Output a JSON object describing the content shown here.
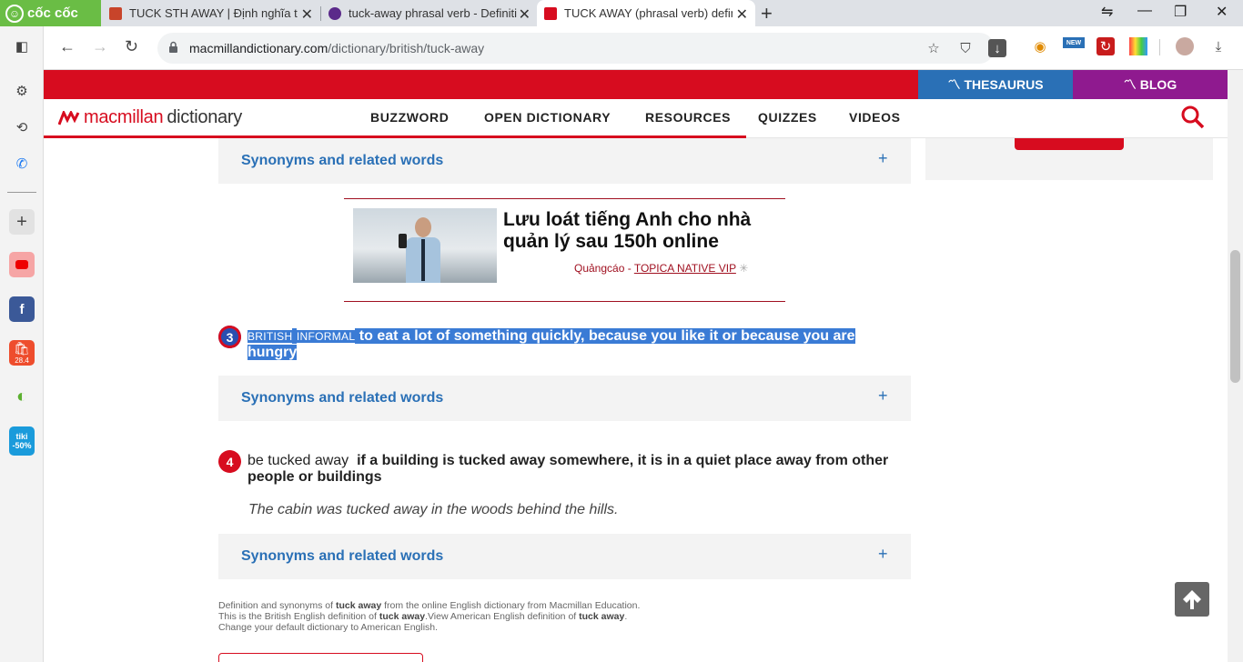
{
  "browser": {
    "brand": "cốc cốc",
    "tabs": [
      {
        "title": "TUCK STH AWAY | Định nghĩa trong",
        "favicon_color": "#c8442a"
      },
      {
        "title": "tuck-away phrasal verb - Definition",
        "favicon_color": "#5b2a8a"
      },
      {
        "title": "TUCK AWAY (phrasal verb) definition",
        "favicon_color": "#d70c1f",
        "active": true
      }
    ],
    "url_host": "macmillandictionary.com",
    "url_path": "/dictionary/british/tuck-away",
    "sidebar_badges": {
      "shopee": "28.4",
      "tiki_top": "tiki",
      "tiki_bottom": "-50%"
    },
    "toolbar_badge": "NEW"
  },
  "site": {
    "logo_brand": "macmillan",
    "logo_dict": " dictionary",
    "top_links": {
      "thesaurus": "THESAURUS",
      "blog": "BLOG"
    },
    "nav": [
      "BUZZWORD",
      "OPEN DICTIONARY",
      "RESOURCES",
      "QUIZZES",
      "VIDEOS"
    ],
    "accent": "#d70c1f",
    "link_color": "#2a70b6"
  },
  "content": {
    "synonyms_label": "Synonyms and related words",
    "plus": "+",
    "ad": {
      "title": "Lưu loát tiếng Anh cho nhà quản lý sau 150h online",
      "source_prefix": "Quảngcáo - ",
      "source_link": "TOPICA NATIVE VIP"
    },
    "sense3": {
      "number": "3",
      "tag1": "BRITISH",
      "tag2": "INFORMAL",
      "definition": "to eat a lot of something quickly, because you like it or because you are hungry"
    },
    "sense4": {
      "number": "4",
      "lead": "be tucked away",
      "definition": "if a building is tucked away somewhere, it is in a quiet place away from other people or buildings",
      "example": "The cabin was tucked away in the woods behind the hills."
    },
    "footer": {
      "l1a": "Definition and synonyms of ",
      "l1b": "tuck away",
      "l1c": " from the online English dictionary from Macmillan Education.",
      "l2a": "This is the British English definition of ",
      "l2b": "tuck away",
      "l2c": ".View American English definition of ",
      "l2d": "tuck away",
      "l2e": ".",
      "l3": "Change your default dictionary to American English."
    }
  }
}
